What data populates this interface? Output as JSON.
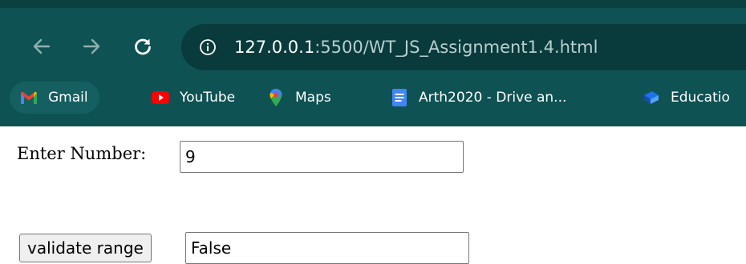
{
  "browser": {
    "url_host": "127.0.0.1",
    "url_rest": ":5500/WT_JS_Assignment1.4.html",
    "colors": {
      "chrome_bg": "#0e5253",
      "omnibox_bg": "#0a3b3c",
      "icon": "#c7dada"
    },
    "nav_icons": [
      "back-arrow-icon",
      "forward-arrow-icon",
      "reload-icon"
    ],
    "bookmarks": [
      {
        "label": "Gmail",
        "icon": "gmail-icon"
      },
      {
        "label": "YouTube",
        "icon": "youtube-icon"
      },
      {
        "label": "Maps",
        "icon": "maps-icon"
      },
      {
        "label": "Arth2020 - Drive an...",
        "icon": "google-docs-icon"
      },
      {
        "label": "Educatio",
        "icon": "education-icon"
      }
    ]
  },
  "page": {
    "number_label": "Enter Number:",
    "number_value": "9",
    "validate_button_label": "validate range",
    "result_value": "False"
  }
}
